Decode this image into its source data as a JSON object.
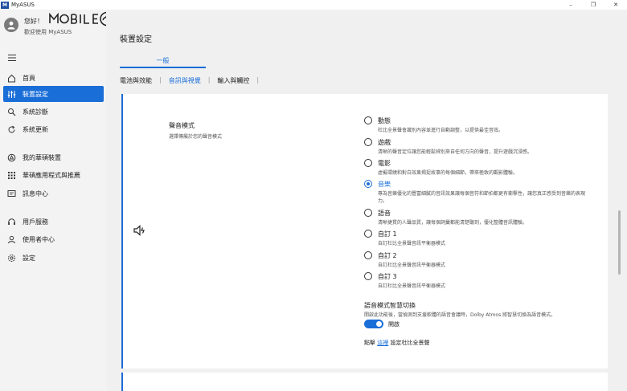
{
  "window": {
    "logo_text": "M",
    "title": "MyASUS",
    "controls": [
      "–",
      "❐",
      "✕"
    ]
  },
  "user": {
    "greeting": "您好！",
    "welcome": "歡迎使用 MyASUS"
  },
  "sidebar": {
    "items": [
      {
        "label": "首頁",
        "icon": "home-icon"
      },
      {
        "label": "裝置設定",
        "icon": "sliders-icon",
        "active": true
      },
      {
        "label": "系統診斷",
        "icon": "diagnosis-icon"
      },
      {
        "label": "系統更新",
        "icon": "update-icon"
      },
      {
        "label": "我的華碩裝置",
        "icon": "device-icon"
      },
      {
        "label": "華碩應用程式與推薦",
        "icon": "apps-grid-icon"
      },
      {
        "label": "訊息中心",
        "icon": "message-icon"
      },
      {
        "label": "用戶服務",
        "icon": "headset-icon"
      },
      {
        "label": "使用者中心",
        "icon": "user-icon"
      },
      {
        "label": "設定",
        "icon": "gear-icon"
      }
    ]
  },
  "main": {
    "title": "裝置設定",
    "subtab": "一般",
    "tabs": [
      "電池與效能",
      "音訊與視覺",
      "輸入與觸控"
    ],
    "active_tab": "音訊與視覺"
  },
  "sound_mode": {
    "title": "聲音模式",
    "description": "選擇傳屬於您的聲音模式",
    "options": [
      {
        "label": "動態",
        "desc": "杜比全景聲會識別內容並進行自動調整，以提供最佳音效。"
      },
      {
        "label": "遊戲",
        "desc": "清晰的聲音定位讓您能輕鬆辨別來自任何方向的聲音，提升遊戲沉浸感。"
      },
      {
        "label": "電影",
        "desc": "虛擬環繞和對白效果揭捉故事的每個細節，帶來極致的觀影體驗。"
      },
      {
        "label": "音樂",
        "desc": "專為音樂優化的豐富細膩的音訊效果讓每個音符和節拍都更有衝擊性，讓您真正感受到音樂的表現力。",
        "checked": true
      },
      {
        "label": "語音",
        "desc": "清晰捷貫的人聲品質，讓每個詞彙都能清楚聽到，優化整體音訊體驗。"
      },
      {
        "label": "自訂 1",
        "desc": "自訂杜比全景聲音訊平衡器模式"
      },
      {
        "label": "自訂 2",
        "desc": "自訂杜比全景聲音訊平衡器模式"
      },
      {
        "label": "自訂 3",
        "desc": "自訂杜比全景聲音訊平衡器模式"
      }
    ]
  },
  "smart_switch": {
    "title": "語音模式智慧切換",
    "description": "開啟此功能後，當偵測到支援軟體的語音會議時，Dolby Atmos 將智慧切換為語音模式。",
    "toggle_label": "開啟",
    "enabled": true
  },
  "footer": {
    "prefix": "點擊",
    "link": "這裡",
    "suffix": "設定杜比全景聲"
  },
  "colors": {
    "accent": "#1a6ed8",
    "sidebar_bg": "#f3f3f3",
    "main_bg": "#f0f0f0",
    "card_bg": "#ffffff"
  }
}
